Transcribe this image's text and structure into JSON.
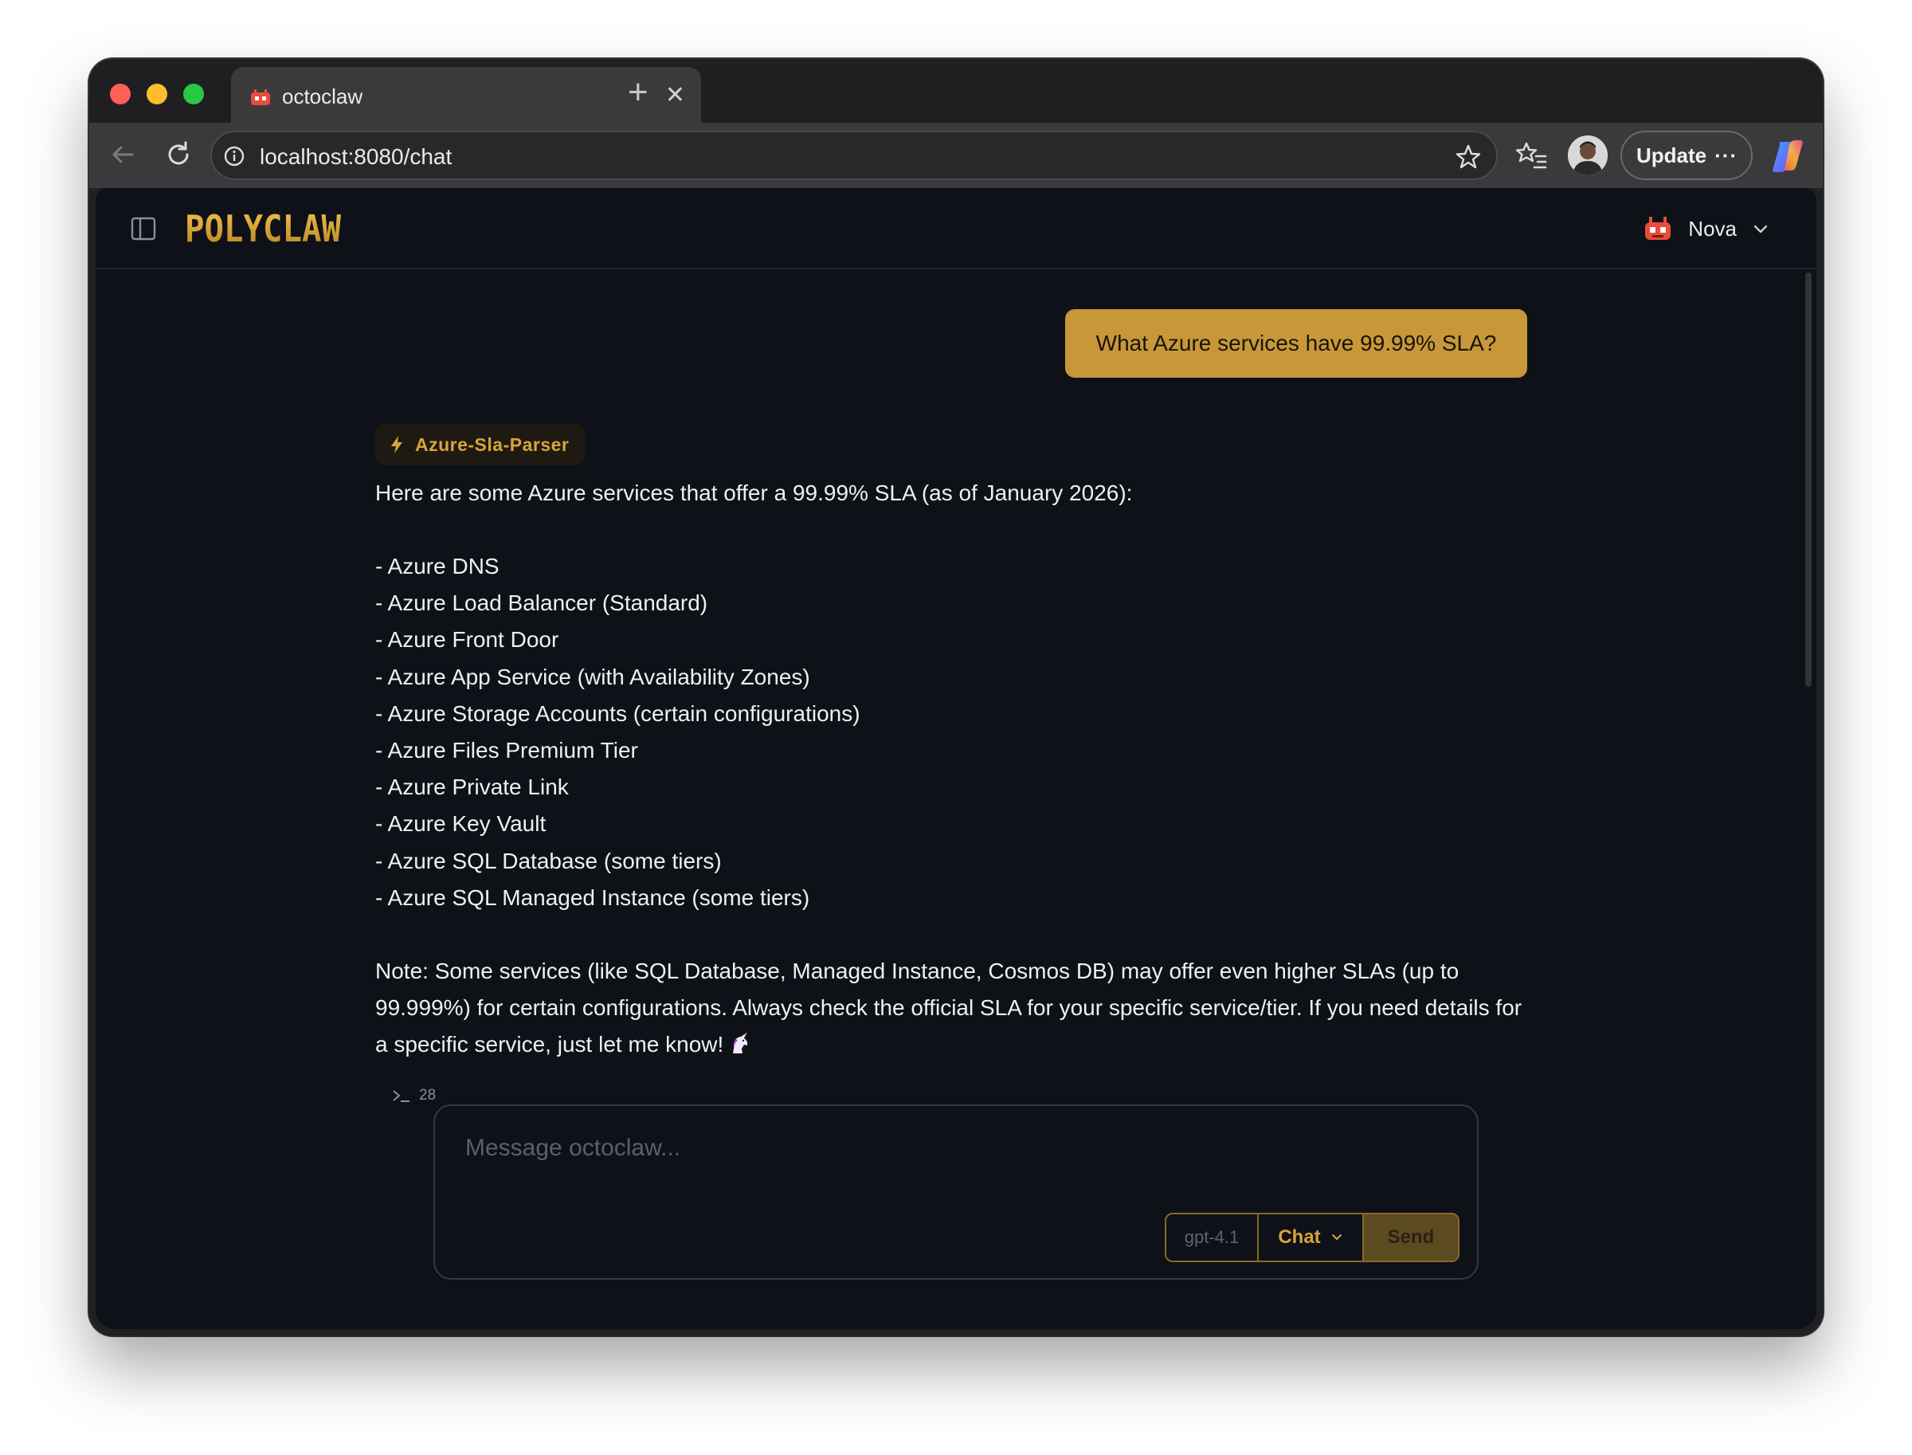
{
  "browser": {
    "tab_title": "octoclaw",
    "tab_close": "✕",
    "new_tab": "+",
    "url": "localhost:8080/chat",
    "update_label": "Update",
    "update_more": "···"
  },
  "app": {
    "logo_text": "POLYCLAW",
    "agent_name": "Nova"
  },
  "conversation": {
    "user_message": "What Azure services have 99.99% SLA?",
    "skill_label": "Azure-Sla-Parser",
    "intro": "Here are some Azure services that offer a 99.99% SLA (as of January 2026):",
    "items": [
      "- Azure DNS",
      "- Azure Load Balancer (Standard)",
      "- Azure Front Door",
      "- Azure App Service (with Availability Zones)",
      "- Azure Storage Accounts (certain configurations)",
      "- Azure Files Premium Tier",
      "- Azure Private Link",
      "- Azure Key Vault",
      "- Azure SQL Database (some tiers)",
      "- Azure SQL Managed Instance (some tiers)"
    ],
    "note": "Note: Some services (like SQL Database, Managed Instance, Cosmos DB) may offer even higher SLAs (up to 99.999%) for certain configurations. Always check the official SLA for your specific service/tier. If you need details for a specific service, just let me know!",
    "tool_count": "28"
  },
  "composer": {
    "placeholder": "Message octoclaw...",
    "model": "gpt-4.1",
    "mode": "Chat",
    "send_label": "Send"
  },
  "colors": {
    "accent": "#c8973a",
    "background": "#0e1117"
  },
  "icons": [
    "close-icon",
    "plus-icon",
    "back-icon",
    "reload-icon",
    "info-icon",
    "star-icon",
    "favorites-icon",
    "copilot-icon",
    "sidebar-toggle-icon",
    "robot-icon",
    "chevron-down-icon",
    "lightning-icon",
    "terminal-icon",
    "unicorn-icon"
  ]
}
